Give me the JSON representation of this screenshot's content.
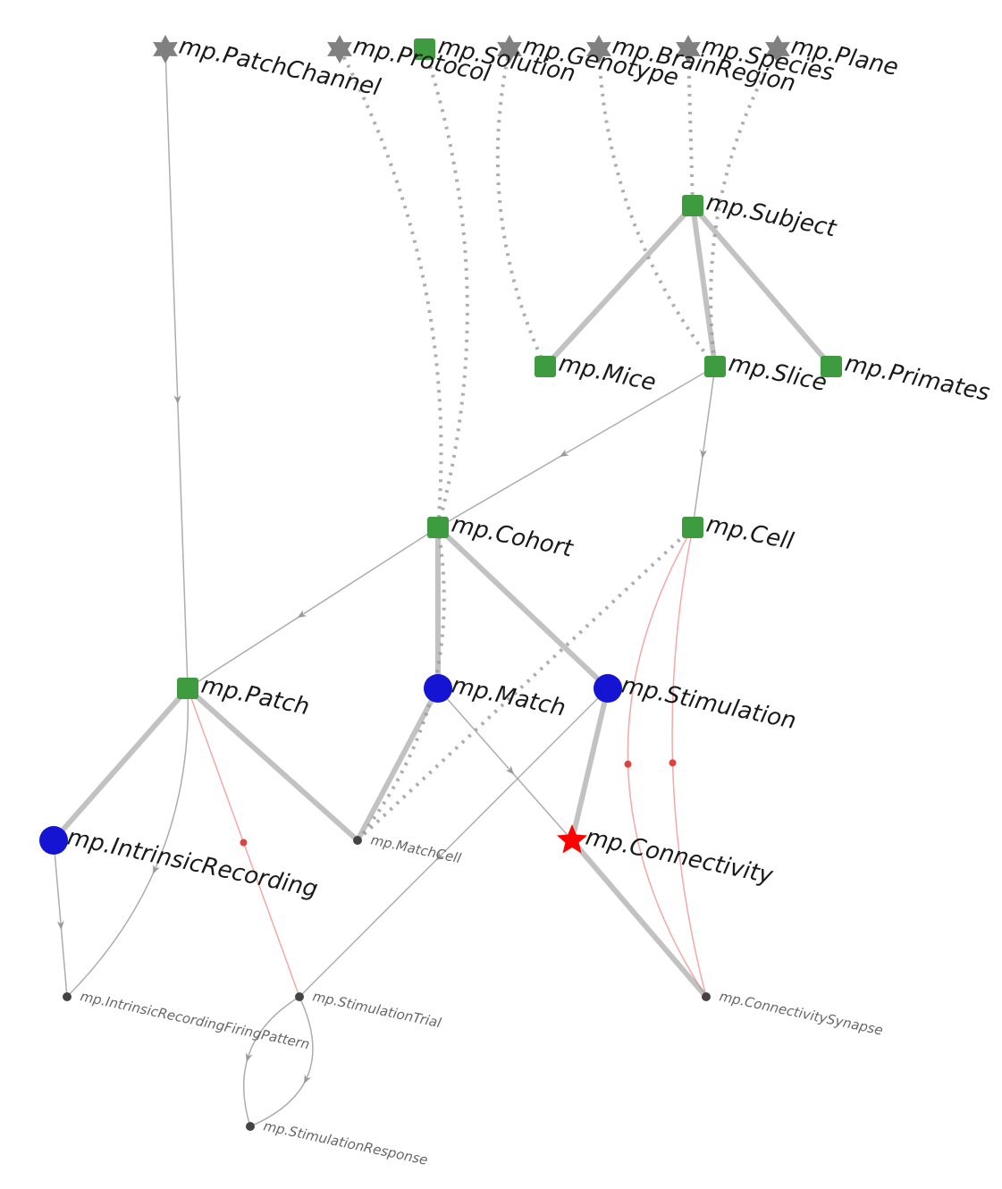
{
  "diagram": {
    "type": "schema-graph",
    "module_prefix": "mp",
    "colors": {
      "lookup_star": "#808080",
      "manual_square": "#3f9b3f",
      "imported_circle": "#1414d2",
      "computed_star": "#ff0000",
      "edge_solid": "#999999",
      "edge_dotted": "#999999",
      "edge_red": "#f4a8a8",
      "small_dot": "#444444"
    },
    "nodes": {
      "patchchannel": {
        "label": "mp.PatchChannel",
        "labelClass": "main"
      },
      "protocol": {
        "label": "mp.Protocol",
        "labelClass": "main"
      },
      "solution": {
        "label": "mp.Solution",
        "labelClass": "main"
      },
      "genotype": {
        "label": "mp.Genotype",
        "labelClass": "main"
      },
      "brainregion": {
        "label": "mp.BrainRegion",
        "labelClass": "main"
      },
      "species": {
        "label": "mp.Species",
        "labelClass": "main"
      },
      "plane": {
        "label": "mp.Plane",
        "labelClass": "main"
      },
      "subject": {
        "label": "mp.Subject",
        "labelClass": "main"
      },
      "mice": {
        "label": "mp.Mice",
        "labelClass": "main"
      },
      "slice": {
        "label": "mp.Slice",
        "labelClass": "main"
      },
      "primates": {
        "label": "mp.Primates",
        "labelClass": "main"
      },
      "cohort": {
        "label": "mp.Cohort",
        "labelClass": "main"
      },
      "cell": {
        "label": "mp.Cell",
        "labelClass": "main"
      },
      "patch": {
        "label": "mp.Patch",
        "labelClass": "main"
      },
      "match": {
        "label": "mp.Match",
        "labelClass": "main"
      },
      "stimulation": {
        "label": "mp.Stimulation",
        "labelClass": "main"
      },
      "intrinsic": {
        "label": "mp.IntrinsicRecording",
        "labelClass": "main"
      },
      "connectivity": {
        "label": "mp.Connectivity",
        "labelClass": "main"
      },
      "matchcell": {
        "label": "mp.MatchCell",
        "labelClass": "small"
      },
      "stimtrial": {
        "label": "mp.StimulationTrial",
        "labelClass": "small"
      },
      "firingpattern": {
        "label": "mp.IntrinsicRecordingFiringPattern",
        "labelClass": "small"
      },
      "connsynapse": {
        "label": "mp.ConnectivitySynapse",
        "labelClass": "small"
      },
      "stimresponse": {
        "label": "mp.StimulationResponse",
        "labelClass": "small"
      }
    },
    "edges": [
      {
        "from": "patchchannel",
        "to": "patch",
        "style": "thin",
        "kind": "arrow"
      },
      {
        "from": "protocol",
        "to": "cohort",
        "style": "dotted",
        "kind": "line",
        "curve": "left"
      },
      {
        "from": "solution",
        "to": "cohort",
        "style": "dotted",
        "kind": "line",
        "curve": "left"
      },
      {
        "from": "genotype",
        "to": "mice",
        "style": "dotted",
        "kind": "line",
        "curve": "right"
      },
      {
        "from": "brainregion",
        "to": "slice",
        "style": "dotted",
        "kind": "line",
        "curve": "right"
      },
      {
        "from": "species",
        "to": "subject",
        "style": "dotted",
        "kind": "line"
      },
      {
        "from": "plane",
        "to": "slice",
        "style": "dotted",
        "kind": "line",
        "curve": "right"
      },
      {
        "from": "subject",
        "to": "mice",
        "style": "thick",
        "kind": "line"
      },
      {
        "from": "subject",
        "to": "slice",
        "style": "thick",
        "kind": "line"
      },
      {
        "from": "subject",
        "to": "primates",
        "style": "thick",
        "kind": "line"
      },
      {
        "from": "slice",
        "to": "cohort",
        "style": "thin",
        "kind": "arrow"
      },
      {
        "from": "slice",
        "to": "cell",
        "style": "thin",
        "kind": "arrow"
      },
      {
        "from": "cohort",
        "to": "patch",
        "style": "thin",
        "kind": "arrow"
      },
      {
        "from": "cohort",
        "to": "match",
        "style": "thick",
        "kind": "line"
      },
      {
        "from": "cohort",
        "to": "stimulation",
        "style": "thick",
        "kind": "line"
      },
      {
        "from": "cohort",
        "to": "matchcell",
        "style": "dotted",
        "kind": "line",
        "curve": "left"
      },
      {
        "from": "cell",
        "to": "matchcell",
        "style": "dotted",
        "kind": "line"
      },
      {
        "from": "cell",
        "to": "connsynapse",
        "style": "red",
        "kind": "dot",
        "curve": "right"
      },
      {
        "from": "cell",
        "to": "connsynapse",
        "style": "red",
        "kind": "dot",
        "curve": "right2"
      },
      {
        "from": "patch",
        "to": "intrinsic",
        "style": "thick",
        "kind": "line"
      },
      {
        "from": "patch",
        "to": "matchcell",
        "style": "thick",
        "kind": "line"
      },
      {
        "from": "patch",
        "to": "stimtrial",
        "style": "red",
        "kind": "dot"
      },
      {
        "from": "patch",
        "to": "firingpattern",
        "style": "thin",
        "kind": "arrow",
        "curve": "left"
      },
      {
        "from": "match",
        "to": "matchcell",
        "style": "thick",
        "kind": "line"
      },
      {
        "from": "match",
        "to": "connectivity",
        "style": "thin",
        "kind": "arrow"
      },
      {
        "from": "stimulation",
        "to": "connectivity",
        "style": "thick",
        "kind": "line"
      },
      {
        "from": "stimulation",
        "to": "stimtrial",
        "style": "thin",
        "kind": "arrow"
      },
      {
        "from": "intrinsic",
        "to": "firingpattern",
        "style": "thin",
        "kind": "arrow"
      },
      {
        "from": "connectivity",
        "to": "connsynapse",
        "style": "thick",
        "kind": "line"
      },
      {
        "from": "stimtrial",
        "to": "stimresponse",
        "style": "thin",
        "kind": "arrow",
        "curve": "left"
      },
      {
        "from": "stimtrial",
        "to": "stimresponse",
        "style": "thin",
        "kind": "arrow",
        "curve": "right"
      }
    ]
  }
}
